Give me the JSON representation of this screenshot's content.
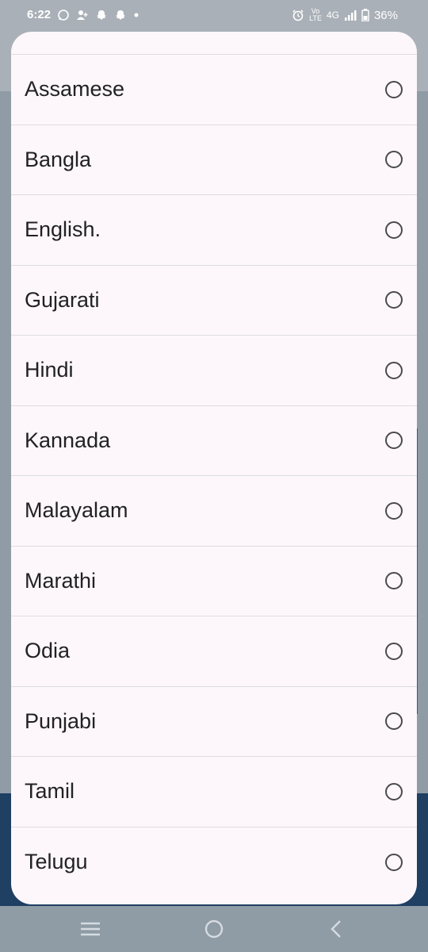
{
  "status_bar": {
    "time": "6:22",
    "battery": "36%",
    "network": "4G",
    "volte_line1": "Vo",
    "volte_line2": "LTE",
    "icons_left": [
      "whatsapp-icon",
      "person-add-icon",
      "snapchat-icon",
      "snapchat-icon",
      "dot-icon"
    ],
    "icons_right": [
      "alarm-icon",
      "volte-icon",
      "signal-icon",
      "battery-icon"
    ]
  },
  "dialog": {
    "languages": [
      {
        "label": "Assamese"
      },
      {
        "label": "Bangla"
      },
      {
        "label": "English."
      },
      {
        "label": "Gujarati"
      },
      {
        "label": "Hindi"
      },
      {
        "label": "Kannada"
      },
      {
        "label": "Malayalam"
      },
      {
        "label": "Marathi"
      },
      {
        "label": "Odia"
      },
      {
        "label": "Punjabi"
      },
      {
        "label": "Tamil"
      },
      {
        "label": "Telugu"
      }
    ]
  },
  "nav_bar": {
    "buttons": [
      "menu-icon",
      "home-icon",
      "back-icon"
    ]
  },
  "colors": {
    "dialog_bg": "#fdf7fc",
    "divider": "#dddddd",
    "text": "#222222",
    "radio": "#4a4a4a",
    "overlay_bottom": "#1f3f63"
  }
}
